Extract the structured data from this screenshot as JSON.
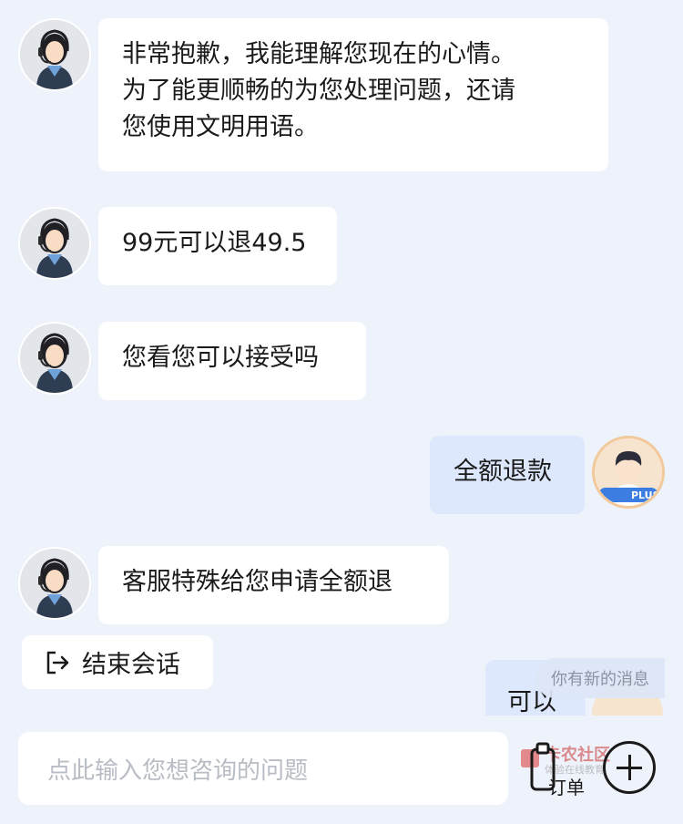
{
  "messages": [
    {
      "from": "agent",
      "text": "非常抱歉，我能理解您现在的心情。\n为了能更顺畅的为您处理问题，还请\n您使用文明用语。"
    },
    {
      "from": "agent",
      "text": "99元可以退49.5"
    },
    {
      "from": "agent",
      "text": "您看您可以接受吗"
    },
    {
      "from": "user",
      "text": "全额退款"
    },
    {
      "from": "agent",
      "text": "客服特殊给您申请全额退"
    },
    {
      "from": "user",
      "text": "可以"
    }
  ],
  "user_badge": "PLUS",
  "end_session": {
    "label": "结束会话",
    "icon": "exit-icon"
  },
  "new_message_toast": "你有新的消息",
  "input": {
    "placeholder": "点此输入您想咨询的问题"
  },
  "order_button": {
    "label": "订单",
    "icon": "order-icon"
  },
  "add_button": {
    "icon": "plus-circle-icon"
  },
  "watermark": {
    "title": "卡农社区",
    "subtitle": "体验在线教育"
  },
  "colors": {
    "background": "#eef3fb",
    "agent_bubble": "#ffffff",
    "user_bubble": "#dde8fc",
    "placeholder": "#b8bcc4"
  }
}
